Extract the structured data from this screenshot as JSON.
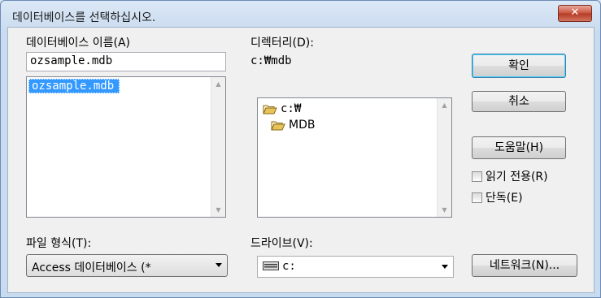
{
  "dialog": {
    "title": "데이터베이스를 선택하십시오.",
    "close_label": "✕"
  },
  "database_name": {
    "label": "데이터베이스 이름(A)",
    "value": "ozsample.mdb",
    "list_items": [
      "ozsample.mdb"
    ]
  },
  "directory": {
    "label": "디렉터리(D):",
    "current": "c:₩mdb",
    "tree": [
      {
        "label": "c:₩",
        "icon": "open-folder-icon"
      },
      {
        "label": "MDB",
        "icon": "open-folder-icon"
      }
    ]
  },
  "buttons": {
    "ok": "확인",
    "cancel": "취소",
    "help": "도움말(H)",
    "network": "네트워크(N)..."
  },
  "checkboxes": {
    "read_only": "읽기 전용(R)",
    "exclusive": "단독(E)"
  },
  "file_type": {
    "label": "파일 형식(T):",
    "value": "Access 데이터베이스 (*"
  },
  "drive": {
    "label": "드라이브(V):",
    "value": "c:",
    "icon": "drive-icon"
  },
  "colors": {
    "selection": "#3399ff",
    "folder": "#e8c35a"
  }
}
